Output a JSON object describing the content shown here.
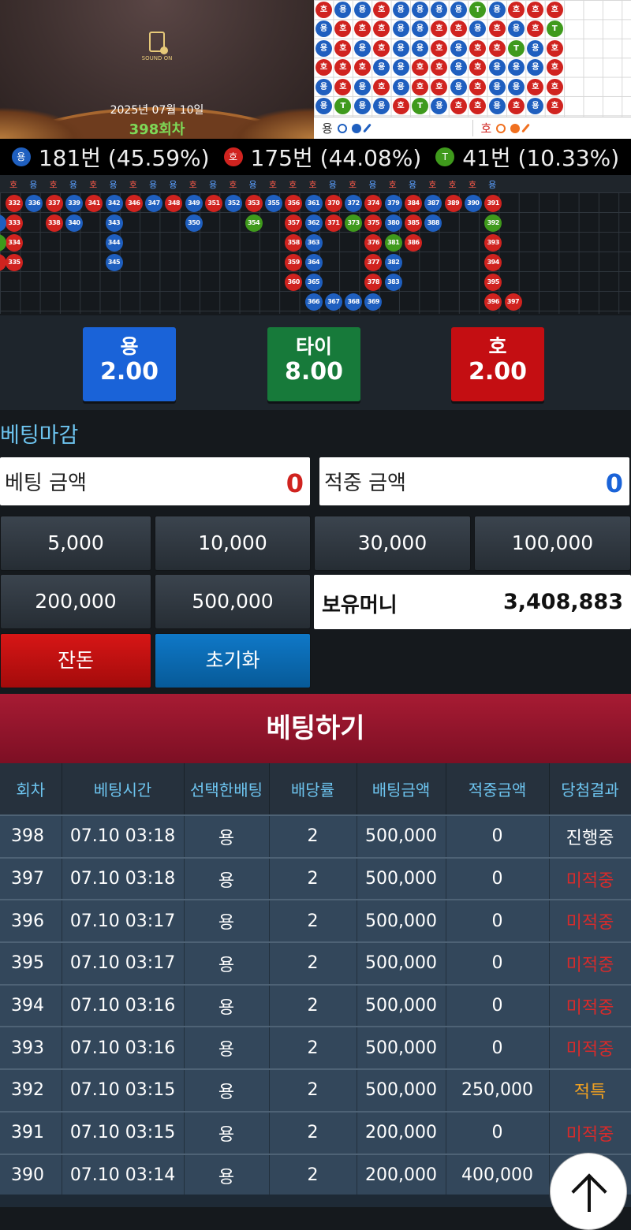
{
  "video": {
    "sound_label": "SOUND ON",
    "date": "2025년 07월 10일",
    "round": "398회차"
  },
  "big_road": {
    "rows": [
      [
        "호",
        "용",
        "용",
        "호",
        "용",
        "용",
        "용",
        "용",
        "T",
        "용",
        "호",
        "호",
        "호"
      ],
      [
        "용",
        "호",
        "호",
        "호",
        "용",
        "용",
        "호",
        "호",
        "용",
        "호",
        "용",
        "호",
        "T"
      ],
      [
        "용",
        "호",
        "용",
        "호",
        "용",
        "용",
        "호",
        "용",
        "호",
        "호",
        "T",
        "용",
        "호"
      ],
      [
        "호",
        "호",
        "호",
        "용",
        "용",
        "호",
        "호",
        "용",
        "호",
        "용",
        "용",
        "용",
        "호"
      ],
      [
        "용",
        "호",
        "용",
        "호",
        "용",
        "호",
        "호",
        "용",
        "호",
        "용",
        "용",
        "호",
        "호"
      ],
      [
        "용",
        "T",
        "용",
        "용",
        "호",
        "T",
        "용",
        "호",
        "호",
        "용",
        "호",
        "용",
        "호"
      ]
    ],
    "legend_dragon": "용",
    "legend_tiger": "호"
  },
  "stats": {
    "dragon_badge": "용",
    "dragon": "181번 (45.59%)",
    "tiger_badge": "호",
    "tiger": "175번 (44.08%)",
    "tie_badge": "T",
    "tie": "41번 (10.33%)"
  },
  "history": {
    "header_labels": [
      "호",
      "용",
      "호",
      "용",
      "호",
      "용",
      "호",
      "용",
      "용",
      "호",
      "용",
      "호",
      "용",
      "호",
      "호",
      "호",
      "용",
      "호",
      "용",
      "호",
      "용",
      "호",
      "호",
      "호",
      "용"
    ],
    "columns": [
      [
        {
          "n": "332",
          "c": "red"
        },
        {
          "n": "333",
          "c": "red"
        },
        {
          "n": "334",
          "c": "red"
        },
        {
          "n": "335",
          "c": "red"
        }
      ],
      [
        {
          "n": "336",
          "c": "blue"
        }
      ],
      [
        {
          "n": "337",
          "c": "red"
        },
        {
          "n": "338",
          "c": "red"
        }
      ],
      [
        {
          "n": "339",
          "c": "blue"
        },
        {
          "n": "340",
          "c": "blue"
        }
      ],
      [
        {
          "n": "341",
          "c": "red"
        }
      ],
      [
        {
          "n": "342",
          "c": "blue"
        },
        {
          "n": "343",
          "c": "blue"
        },
        {
          "n": "344",
          "c": "blue"
        },
        {
          "n": "345",
          "c": "blue"
        }
      ],
      [
        {
          "n": "346",
          "c": "red"
        }
      ],
      [
        {
          "n": "347",
          "c": "blue"
        }
      ],
      [
        {
          "n": "348",
          "c": "red"
        }
      ],
      [
        {
          "n": "349",
          "c": "blue"
        },
        {
          "n": "350",
          "c": "blue"
        }
      ],
      [
        {
          "n": "351",
          "c": "red"
        }
      ],
      [
        {
          "n": "352",
          "c": "blue"
        }
      ],
      [
        {
          "n": "353",
          "c": "red"
        },
        {
          "n": "354",
          "c": "green"
        }
      ],
      [
        {
          "n": "355",
          "c": "blue"
        }
      ],
      [
        {
          "n": "356",
          "c": "red"
        },
        {
          "n": "357",
          "c": "red"
        },
        {
          "n": "358",
          "c": "red"
        },
        {
          "n": "359",
          "c": "red"
        },
        {
          "n": "360",
          "c": "red"
        }
      ],
      [
        {
          "n": "361",
          "c": "blue"
        },
        {
          "n": "362",
          "c": "blue"
        },
        {
          "n": "363",
          "c": "blue"
        },
        {
          "n": "364",
          "c": "blue"
        },
        {
          "n": "365",
          "c": "blue"
        },
        {
          "n": "366",
          "c": "blue"
        }
      ],
      [
        {
          "n": "370",
          "c": "red"
        },
        {
          "n": "371",
          "c": "red"
        },
        null,
        null,
        null,
        {
          "n": "367",
          "c": "blue"
        }
      ],
      [
        {
          "n": "372",
          "c": "blue"
        },
        {
          "n": "373",
          "c": "green"
        },
        null,
        null,
        null,
        {
          "n": "368",
          "c": "blue"
        }
      ],
      [
        {
          "n": "374",
          "c": "red"
        },
        {
          "n": "375",
          "c": "red"
        },
        {
          "n": "376",
          "c": "red"
        },
        {
          "n": "377",
          "c": "red"
        },
        {
          "n": "378",
          "c": "red"
        },
        {
          "n": "369",
          "c": "blue"
        }
      ],
      [
        {
          "n": "379",
          "c": "blue"
        },
        {
          "n": "380",
          "c": "blue"
        },
        {
          "n": "381",
          "c": "green"
        },
        {
          "n": "382",
          "c": "blue"
        },
        {
          "n": "383",
          "c": "blue"
        }
      ],
      [
        {
          "n": "384",
          "c": "red"
        },
        {
          "n": "385",
          "c": "red"
        },
        {
          "n": "386",
          "c": "red"
        }
      ],
      [
        {
          "n": "387",
          "c": "blue"
        },
        {
          "n": "388",
          "c": "blue"
        }
      ],
      [
        {
          "n": "389",
          "c": "red"
        }
      ],
      [
        {
          "n": "390",
          "c": "blue"
        }
      ],
      [
        {
          "n": "391",
          "c": "red"
        },
        {
          "n": "392",
          "c": "green"
        },
        {
          "n": "393",
          "c": "red"
        },
        {
          "n": "394",
          "c": "red"
        },
        {
          "n": "395",
          "c": "red"
        },
        {
          "n": "396",
          "c": "red"
        }
      ],
      [
        null,
        null,
        null,
        null,
        null,
        {
          "n": "397",
          "c": "red"
        }
      ]
    ],
    "left_partial": [
      null,
      {
        "n": "",
        "c": "blue"
      },
      {
        "n": "",
        "c": "green"
      },
      {
        "n": "",
        "c": "red"
      }
    ]
  },
  "odds": {
    "dragon": {
      "label": "용",
      "value": "2.00",
      "color": "#1a63d8"
    },
    "tie": {
      "label": "타이",
      "value": "8.00",
      "color": "#177a3a"
    },
    "tiger": {
      "label": "호",
      "value": "2.00",
      "color": "#c40e12"
    }
  },
  "bet_status": "베팅마감",
  "bet_amount": {
    "label": "베팅 금액",
    "value": "0"
  },
  "win_amount": {
    "label": "적중 금액",
    "value": "0"
  },
  "chips": [
    "5,000",
    "10,000",
    "30,000",
    "100,000",
    "200,000",
    "500,000"
  ],
  "balance": {
    "label": "보유머니",
    "value": "3,408,883"
  },
  "change_button": "잔돈",
  "reset_button": "초기화",
  "bet_button": "베팅하기",
  "bets_table": {
    "headers": [
      "회차",
      "베팅시간",
      "선택한배팅",
      "배당률",
      "배팅금액",
      "적중금액",
      "당첨결과"
    ],
    "rows": [
      {
        "round": "398",
        "time": "07.10 03:18",
        "pick": "용",
        "odds": "2",
        "amount": "500,000",
        "win": "0",
        "result": "진행중",
        "status": "pending"
      },
      {
        "round": "397",
        "time": "07.10 03:18",
        "pick": "용",
        "odds": "2",
        "amount": "500,000",
        "win": "0",
        "result": "미적중",
        "status": "miss"
      },
      {
        "round": "396",
        "time": "07.10 03:17",
        "pick": "용",
        "odds": "2",
        "amount": "500,000",
        "win": "0",
        "result": "미적중",
        "status": "miss"
      },
      {
        "round": "395",
        "time": "07.10 03:17",
        "pick": "용",
        "odds": "2",
        "amount": "500,000",
        "win": "0",
        "result": "미적중",
        "status": "miss"
      },
      {
        "round": "394",
        "time": "07.10 03:16",
        "pick": "용",
        "odds": "2",
        "amount": "500,000",
        "win": "0",
        "result": "미적중",
        "status": "miss"
      },
      {
        "round": "393",
        "time": "07.10 03:16",
        "pick": "용",
        "odds": "2",
        "amount": "500,000",
        "win": "0",
        "result": "미적중",
        "status": "miss"
      },
      {
        "round": "392",
        "time": "07.10 03:15",
        "pick": "용",
        "odds": "2",
        "amount": "500,000",
        "win": "250,000",
        "result": "적특",
        "status": "hit"
      },
      {
        "round": "391",
        "time": "07.10 03:15",
        "pick": "용",
        "odds": "2",
        "amount": "200,000",
        "win": "0",
        "result": "미적중",
        "status": "miss"
      },
      {
        "round": "390",
        "time": "07.10 03:14",
        "pick": "용",
        "odds": "2",
        "amount": "200,000",
        "win": "400,000",
        "result": "",
        "status": "hit"
      }
    ]
  },
  "colors": {
    "dragon": "#1f5fbf",
    "tiger": "#d0231f",
    "tie": "#3f9a1c",
    "accent": "#6dc4ef"
  }
}
